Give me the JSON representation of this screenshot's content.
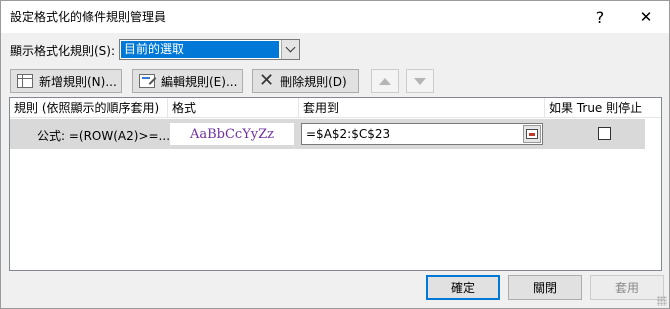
{
  "window": {
    "title": "設定格式化的條件規則管理員",
    "help_label": "?",
    "close_label": "✕"
  },
  "scope": {
    "label": "顯示格式化規則(S):",
    "selected": "目前的選取"
  },
  "toolbar": {
    "new_rule": "新增規則(N)...",
    "edit_rule": "編輯規則(E)...",
    "delete_rule": "刪除規則(D)"
  },
  "grid": {
    "headers": [
      "規則 (依照顯示的順序套用)",
      "格式",
      "套用到",
      "如果 True 則停止"
    ],
    "rows": [
      {
        "rule": "公式: =(ROW(A2)>=...",
        "format_sample": "AaBbCcYyZz",
        "applies_to": "=$A$2:$C$23",
        "stop_if_true": false
      }
    ]
  },
  "footer": {
    "ok": "確定",
    "close": "關閉",
    "apply": "套用"
  },
  "colors": {
    "selection": "#0078d7",
    "format_text": "#7030a0",
    "row_highlight": "#d9d9d9"
  }
}
